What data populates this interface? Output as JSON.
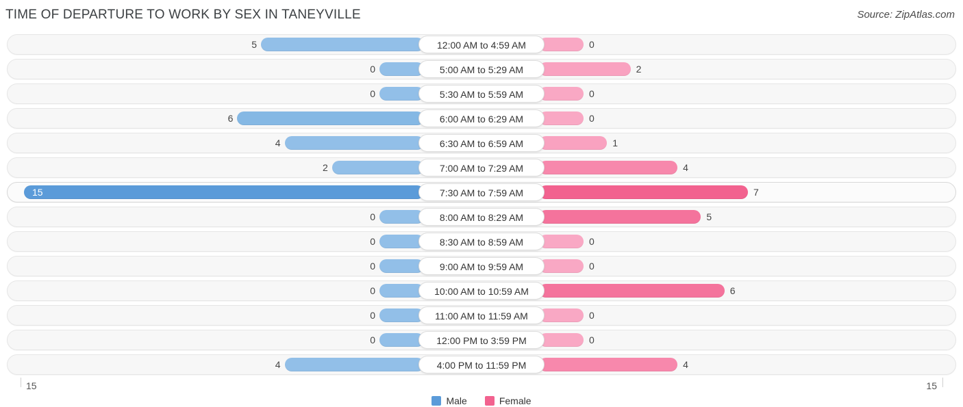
{
  "header": {
    "title": "TIME OF DEPARTURE TO WORK BY SEX IN TANEYVILLE",
    "source": "Source: ZipAtlas.com"
  },
  "axis": {
    "left_label": "15",
    "right_label": "15"
  },
  "legend": {
    "items": [
      {
        "label": "Male",
        "color": "#5b9bd9"
      },
      {
        "label": "Female",
        "color": "#f2628f"
      }
    ]
  },
  "chart_data": {
    "type": "bar",
    "subtype": "diverging-bidirectional-bar",
    "title": "TIME OF DEPARTURE TO WORK BY SEX IN TANEYVILLE",
    "xlabel": "",
    "ylabel": "",
    "xlim": [
      15,
      15
    ],
    "grid": false,
    "legend_position": "bottom-center",
    "categories": [
      "12:00 AM to 4:59 AM",
      "5:00 AM to 5:29 AM",
      "5:30 AM to 5:59 AM",
      "6:00 AM to 6:29 AM",
      "6:30 AM to 6:59 AM",
      "7:00 AM to 7:29 AM",
      "7:30 AM to 7:59 AM",
      "8:00 AM to 8:29 AM",
      "8:30 AM to 8:59 AM",
      "9:00 AM to 9:59 AM",
      "10:00 AM to 10:59 AM",
      "11:00 AM to 11:59 AM",
      "12:00 PM to 3:59 PM",
      "4:00 PM to 11:59 PM"
    ],
    "series": [
      {
        "name": "Male",
        "values": [
          5,
          0,
          0,
          6,
          4,
          2,
          15,
          0,
          0,
          0,
          0,
          0,
          0,
          4
        ]
      },
      {
        "name": "Female",
        "values": [
          0,
          2,
          0,
          0,
          1,
          4,
          7,
          5,
          0,
          0,
          6,
          0,
          0,
          4
        ]
      }
    ]
  },
  "rows": [
    {
      "label": "12:00 AM to 4:59 AM",
      "male": "5",
      "female": "0"
    },
    {
      "label": "5:00 AM to 5:29 AM",
      "male": "0",
      "female": "2"
    },
    {
      "label": "5:30 AM to 5:59 AM",
      "male": "0",
      "female": "0"
    },
    {
      "label": "6:00 AM to 6:29 AM",
      "male": "6",
      "female": "0"
    },
    {
      "label": "6:30 AM to 6:59 AM",
      "male": "4",
      "female": "1"
    },
    {
      "label": "7:00 AM to 7:29 AM",
      "male": "2",
      "female": "4"
    },
    {
      "label": "7:30 AM to 7:59 AM",
      "male": "15",
      "female": "7"
    },
    {
      "label": "8:00 AM to 8:29 AM",
      "male": "0",
      "female": "5"
    },
    {
      "label": "8:30 AM to 8:59 AM",
      "male": "0",
      "female": "0"
    },
    {
      "label": "9:00 AM to 9:59 AM",
      "male": "0",
      "female": "0"
    },
    {
      "label": "10:00 AM to 10:59 AM",
      "male": "0",
      "female": "6"
    },
    {
      "label": "11:00 AM to 11:59 AM",
      "male": "0",
      "female": "0"
    },
    {
      "label": "12:00 PM to 3:59 PM",
      "male": "0",
      "female": "0"
    },
    {
      "label": "4:00 PM to 11:59 PM",
      "male": "4",
      "female": "4"
    }
  ]
}
